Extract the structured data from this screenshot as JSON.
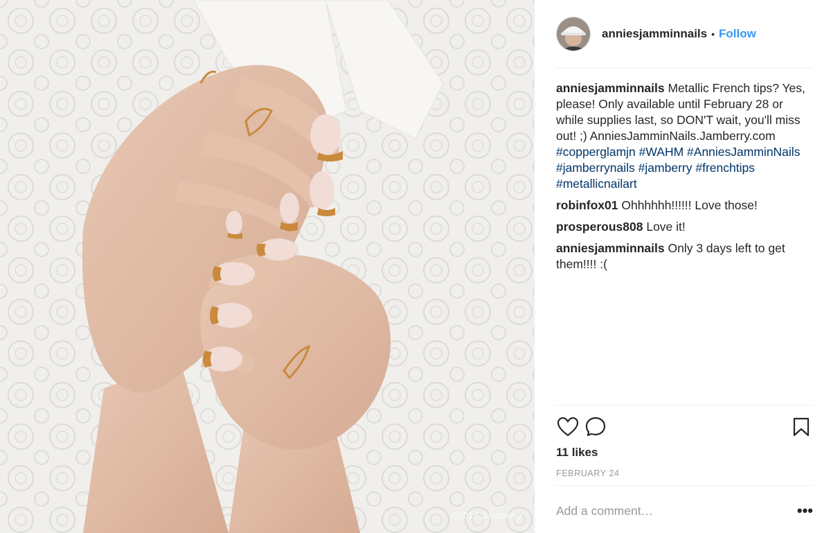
{
  "photo": {
    "watermark": "©2017 Jamberry"
  },
  "header": {
    "username": "anniesjamminnails",
    "separator": "•",
    "follow_label": "Follow"
  },
  "caption": {
    "username": "anniesjamminnails",
    "text": "Metallic French tips? Yes, please! Only available until February 28 or while supplies last, so DON'T wait, you'll miss out! ;) AnniesJamminNails.Jamberry.com",
    "hashtags": [
      "#copperglamjn",
      "#WAHM",
      "#AnniesJamminNails",
      "#jamberrynails",
      "#jamberry",
      "#frenchtips",
      "#metallicnailart"
    ]
  },
  "comments": [
    {
      "username": "robinfox01",
      "text": "Ohhhhhh!!!!!! Love those!"
    },
    {
      "username": "prosperous808",
      "text": "Love it!"
    },
    {
      "username": "anniesjamminnails",
      "text": "Only 3 days left to get them!!!! :("
    }
  ],
  "actions": {
    "like_icon": "heart-icon",
    "comment_icon": "comment-icon",
    "save_icon": "bookmark-icon"
  },
  "likes": "11 likes",
  "date": "FEBRUARY 24",
  "add_comment": {
    "placeholder": "Add a comment…",
    "more_label": "•••"
  },
  "colors": {
    "link": "#3897f0",
    "hashtag": "#003569",
    "text": "#262626",
    "muted": "#999999"
  }
}
